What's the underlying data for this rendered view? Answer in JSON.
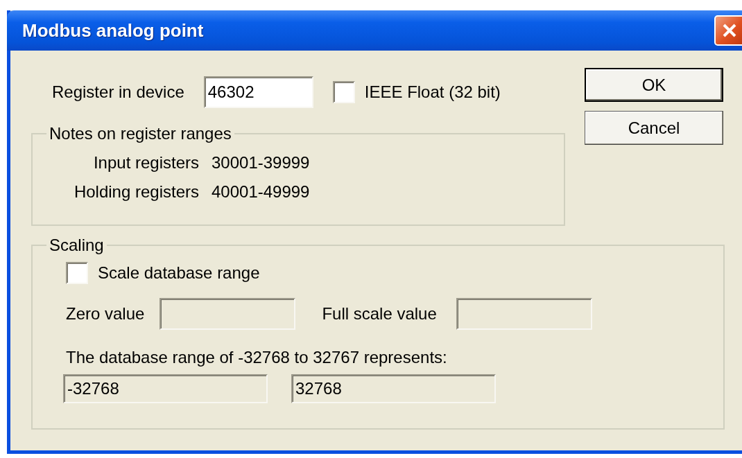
{
  "window": {
    "title": "Modbus analog point"
  },
  "register": {
    "label": "Register in device",
    "value": "46302"
  },
  "ieee_float": {
    "label": "IEEE Float (32 bit)",
    "checked": false
  },
  "buttons": [
    {
      "label": "OK",
      "default": true
    },
    {
      "label": "Cancel",
      "default": false
    }
  ],
  "notes_group": {
    "title": "Notes on register ranges",
    "rows": [
      {
        "label": "Input registers",
        "range": "30001-39999"
      },
      {
        "label": "Holding registers",
        "range": "40001-49999"
      }
    ]
  },
  "scaling_group": {
    "title": "Scaling",
    "scale_checkbox": {
      "label": "Scale database range",
      "checked": false
    },
    "zero_value": {
      "label": "Zero value",
      "disabled": true
    },
    "full_scale_value": {
      "label": "Full scale value",
      "disabled": true
    },
    "range_sentence": "The database range of -32768 to 32767 represents:",
    "range_fields": [
      {
        "value": "-32768",
        "disabled": true
      },
      {
        "value": "32768",
        "disabled": true
      }
    ]
  }
}
